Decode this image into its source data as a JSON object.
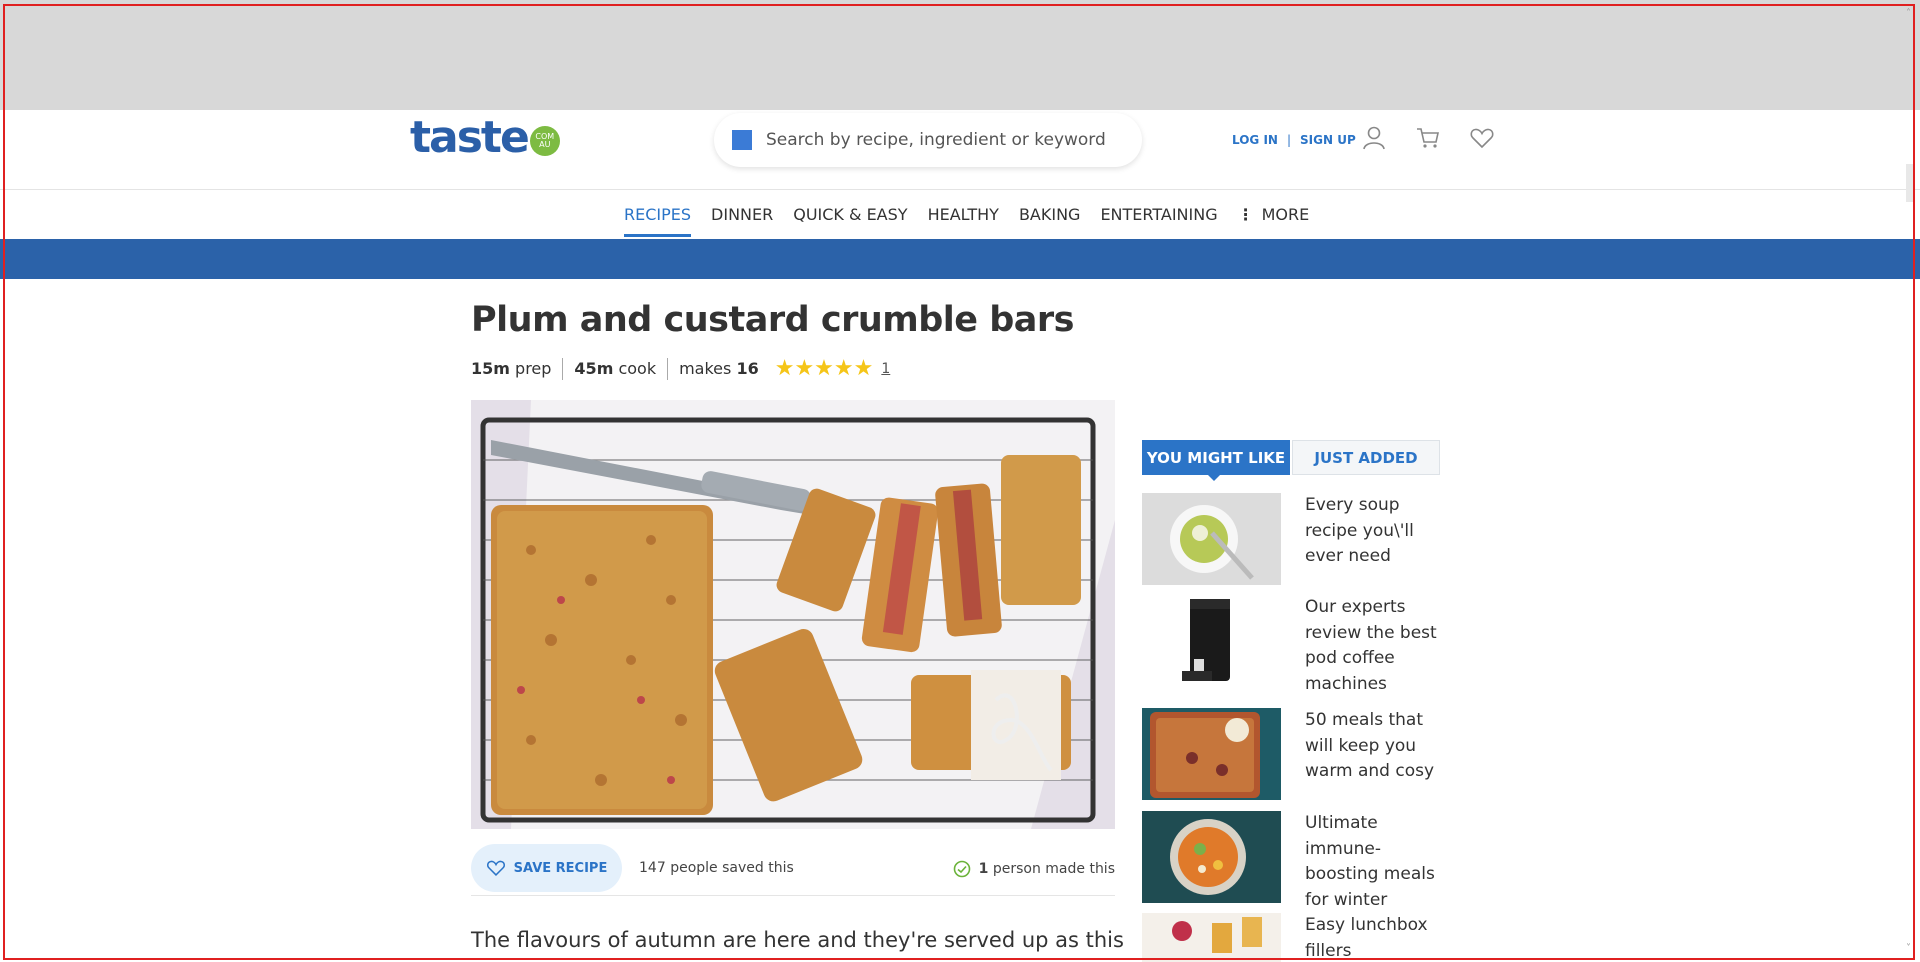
{
  "header": {
    "logo_text": "taste",
    "logo_badge_top": "COM",
    "logo_badge_bottom": "AU",
    "search_placeholder": "Search by recipe, ingredient or keyword",
    "login": "LOG IN",
    "separator": "|",
    "signup": "SIGN UP"
  },
  "nav": {
    "items": [
      "RECIPES",
      "DINNER",
      "QUICK & EASY",
      "HEALTHY",
      "BAKING",
      "ENTERTAINING"
    ],
    "more": "MORE",
    "more_icon": "⋮"
  },
  "recipe": {
    "title": "Plum and custard crumble bars",
    "prep_value": "15m",
    "prep_label": "prep",
    "cook_value": "45m",
    "cook_label": "cook",
    "makes_label": "makes",
    "makes_value": "16",
    "stars": "★★★★★",
    "rating": 5,
    "rating_count": "1",
    "save_label": "SAVE RECIPE",
    "saved_count": "147",
    "saved_label": "people saved this",
    "made_count": "1",
    "made_label": "person made this",
    "intro": "The flavours of autumn are here and they're served up as this"
  },
  "sidebar": {
    "tabs": [
      "YOU MIGHT LIKE",
      "JUST ADDED"
    ],
    "items": [
      "Every soup recipe you\\'ll ever need",
      "Our experts review the best pod coffee machines",
      "50 meals that will keep you warm and cosy",
      "Ultimate immune-boosting meals for winter",
      "Easy lunchbox fillers"
    ]
  },
  "colors": {
    "brand_blue": "#2b62a9",
    "link_blue": "#2b74c7",
    "star": "#f5c518",
    "badge_green": "#7dbb42"
  }
}
